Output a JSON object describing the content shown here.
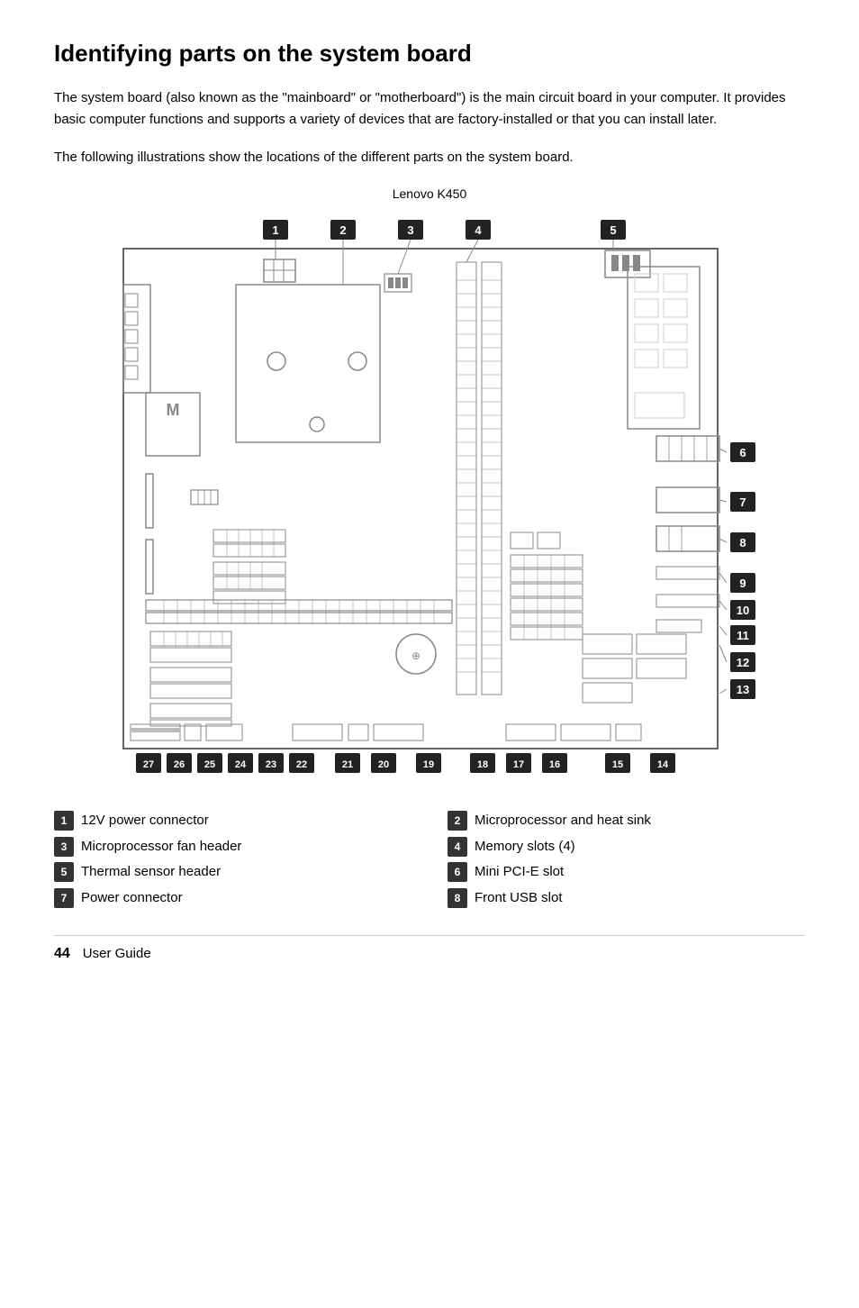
{
  "page": {
    "title": "Identifying parts on the system board",
    "intro1": "The system board (also known as the \"mainboard\" or \"motherboard\") is the main circuit board in your computer. It provides basic computer functions and supports a variety of devices that are factory-installed or that you can install later.",
    "intro2": "The following illustrations show the locations of the different parts on the system board.",
    "diagram_caption": "Lenovo K450",
    "page_number": "44",
    "page_label": "User Guide"
  },
  "parts": [
    {
      "num": "1",
      "label": "12V power connector"
    },
    {
      "num": "2",
      "label": "Microprocessor and heat sink"
    },
    {
      "num": "3",
      "label": "Microprocessor fan header"
    },
    {
      "num": "4",
      "label": "Memory slots (4)"
    },
    {
      "num": "5",
      "label": "Thermal sensor header"
    },
    {
      "num": "6",
      "label": "Mini PCI-E slot"
    },
    {
      "num": "7",
      "label": "Power connector"
    },
    {
      "num": "8",
      "label": "Front USB slot"
    }
  ]
}
